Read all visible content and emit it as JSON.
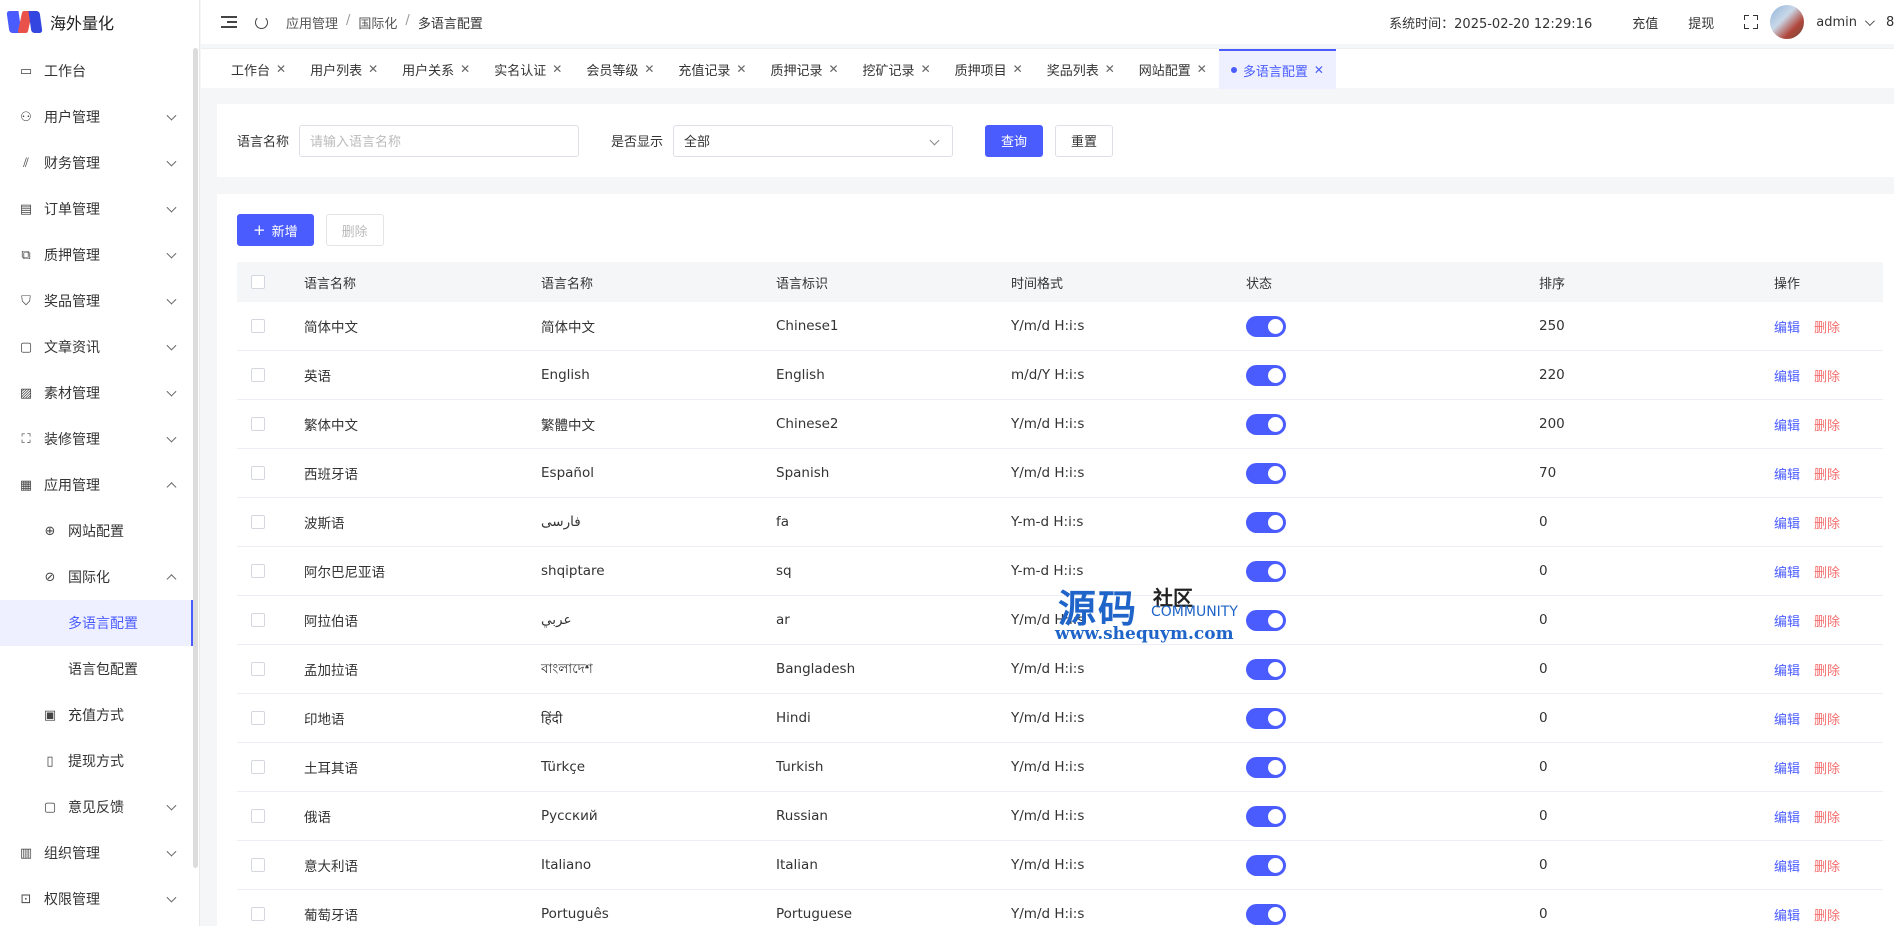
{
  "app": {
    "title": "海外量化"
  },
  "sidebar": {
    "items": [
      {
        "label": "工作台",
        "icon": "monitor-icon",
        "level": 0,
        "expanded": null
      },
      {
        "label": "用户管理",
        "icon": "user-icon",
        "level": 0,
        "expanded": false
      },
      {
        "label": "财务管理",
        "icon": "chart-icon",
        "level": 0,
        "expanded": false
      },
      {
        "label": "订单管理",
        "icon": "order-icon",
        "level": 0,
        "expanded": false
      },
      {
        "label": "质押管理",
        "icon": "copy-icon",
        "level": 0,
        "expanded": false
      },
      {
        "label": "奖品管理",
        "icon": "bag-icon",
        "level": 0,
        "expanded": false
      },
      {
        "label": "文章资讯",
        "icon": "message-icon",
        "level": 0,
        "expanded": false
      },
      {
        "label": "素材管理",
        "icon": "picture-icon",
        "level": 0,
        "expanded": false
      },
      {
        "label": "装修管理",
        "icon": "brush-icon",
        "level": 0,
        "expanded": false
      },
      {
        "label": "应用管理",
        "icon": "app-icon",
        "level": 0,
        "expanded": true
      },
      {
        "label": "网站配置",
        "icon": "globe-icon",
        "level": 1,
        "expanded": null
      },
      {
        "label": "国际化",
        "icon": "international-icon",
        "level": 1,
        "expanded": true
      },
      {
        "label": "多语言配置",
        "icon": "",
        "level": 2,
        "expanded": null,
        "active": true
      },
      {
        "label": "语言包配置",
        "icon": "",
        "level": 2,
        "expanded": null
      },
      {
        "label": "充值方式",
        "icon": "wallet-icon",
        "level": 1,
        "expanded": null
      },
      {
        "label": "提现方式",
        "icon": "folder-icon",
        "level": 1,
        "expanded": null
      },
      {
        "label": "意见反馈",
        "icon": "feedback-icon",
        "level": 1,
        "expanded": false
      },
      {
        "label": "组织管理",
        "icon": "org-icon",
        "level": 0,
        "expanded": false
      },
      {
        "label": "权限管理",
        "icon": "lock-icon",
        "level": 0,
        "expanded": false
      }
    ]
  },
  "header": {
    "breadcrumb": [
      "应用管理",
      "国际化",
      "多语言配置"
    ],
    "system_time_label": "系统时间：",
    "system_time": "2025-02-20 12:29:16",
    "recharge": "充值",
    "withdraw": "提现",
    "username": "admin",
    "clipped_text": "8"
  },
  "tabs": [
    {
      "label": "工作台",
      "active": false
    },
    {
      "label": "用户列表",
      "active": false
    },
    {
      "label": "用户关系",
      "active": false
    },
    {
      "label": "实名认证",
      "active": false
    },
    {
      "label": "会员等级",
      "active": false
    },
    {
      "label": "充值记录",
      "active": false
    },
    {
      "label": "质押记录",
      "active": false
    },
    {
      "label": "挖矿记录",
      "active": false
    },
    {
      "label": "质押项目",
      "active": false
    },
    {
      "label": "奖品列表",
      "active": false
    },
    {
      "label": "网站配置",
      "active": false
    },
    {
      "label": "多语言配置",
      "active": true
    }
  ],
  "search": {
    "name_label": "语言名称",
    "name_placeholder": "请输入语言名称",
    "show_label": "是否显示",
    "show_value": "全部",
    "query_button": "查询",
    "reset_button": "重置"
  },
  "toolbar": {
    "add_button": "新增",
    "delete_button": "删除"
  },
  "table": {
    "columns": [
      "语言名称",
      "语言名称",
      "语言标识",
      "时间格式",
      "状态",
      "排序",
      "操作"
    ],
    "edit_label": "编辑",
    "delete_label": "删除",
    "rows": [
      {
        "name": "简体中文",
        "native": "简体中文",
        "code": "Chinese1",
        "format": "Y/m/d H:i:s",
        "enabled": true,
        "sort": "250"
      },
      {
        "name": "英语",
        "native": "English",
        "code": "English",
        "format": "m/d/Y H:i:s",
        "enabled": true,
        "sort": "220"
      },
      {
        "name": "繁体中文",
        "native": "繁體中文",
        "code": "Chinese2",
        "format": "Y/m/d H:i:s",
        "enabled": true,
        "sort": "200"
      },
      {
        "name": "西班牙语",
        "native": "Español",
        "code": "Spanish",
        "format": "Y/m/d H:i:s",
        "enabled": true,
        "sort": "70"
      },
      {
        "name": "波斯语",
        "native": "فارسی",
        "code": "fa",
        "format": "Y-m-d H:i:s",
        "enabled": true,
        "sort": "0"
      },
      {
        "name": "阿尔巴尼亚语",
        "native": "shqiptare",
        "code": "sq",
        "format": "Y-m-d H:i:s",
        "enabled": true,
        "sort": "0"
      },
      {
        "name": "阿拉伯语",
        "native": "عربي",
        "code": "ar",
        "format": "Y/m/d H:i:s",
        "enabled": true,
        "sort": "0"
      },
      {
        "name": "孟加拉语",
        "native": "বাংলাদেশ",
        "code": "Bangladesh",
        "format": "Y/m/d H:i:s",
        "enabled": true,
        "sort": "0"
      },
      {
        "name": "印地语",
        "native": "हिंदी",
        "code": "Hindi",
        "format": "Y/m/d H:i:s",
        "enabled": true,
        "sort": "0"
      },
      {
        "name": "土耳其语",
        "native": "Türkçe",
        "code": "Turkish",
        "format": "Y/m/d H:i:s",
        "enabled": true,
        "sort": "0"
      },
      {
        "name": "俄语",
        "native": "Русский",
        "code": "Russian",
        "format": "Y/m/d H:i:s",
        "enabled": true,
        "sort": "0"
      },
      {
        "name": "意大利语",
        "native": "Italiano",
        "code": "Italian",
        "format": "Y/m/d H:i:s",
        "enabled": true,
        "sort": "0"
      },
      {
        "name": "葡萄牙语",
        "native": "Português",
        "code": "Portuguese",
        "format": "Y/m/d H:i:s",
        "enabled": true,
        "sort": "0"
      }
    ]
  },
  "watermark": {
    "big": "源码",
    "small1": "社区",
    "small2": "COMMUNITY",
    "url": "www.shequym.com"
  },
  "colors": {
    "accent": "#4b5cff",
    "danger": "#f56c6c",
    "watermark": "#1f64c8"
  }
}
